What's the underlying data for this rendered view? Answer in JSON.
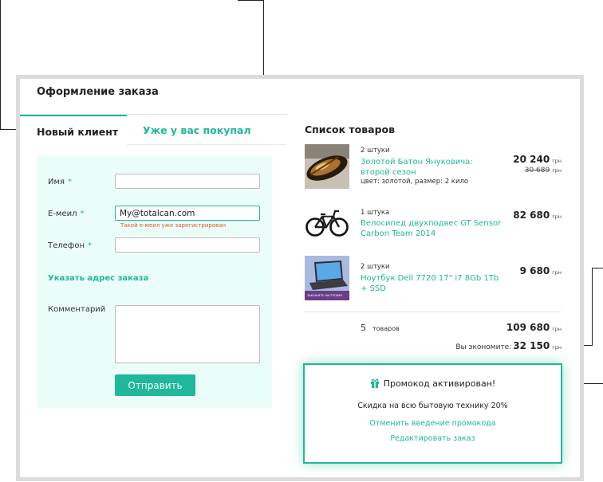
{
  "header": {
    "title": "Оформление заказа"
  },
  "tabs": [
    {
      "label": "Новый клиент",
      "active": true
    },
    {
      "label": "Уже у вас покупал",
      "active": false
    }
  ],
  "form": {
    "name_label": "Имя",
    "email_label": "Е-меил",
    "phone_label": "Телефон",
    "required_mark": "*",
    "name_value": "",
    "email_value": "My@totalcan.com",
    "phone_value": "",
    "email_error": "Такой е-меил уже зарегистрирован",
    "address_link": "Указать адрес заказа",
    "comment_label": "Комментарий",
    "comment_value": "",
    "submit_label": "Отправить"
  },
  "cart": {
    "title": "Список товаров",
    "currency": "грн",
    "items": [
      {
        "qty": "2 штуки",
        "name": "Золотой Батон Януковича: второй сезон",
        "meta": "цвет: золотой, размер: 2 кило",
        "price": "20 240",
        "old_price": "30 689",
        "image": "golden-loaf-image"
      },
      {
        "qty": "1 штука",
        "name": "Велосипед двухподвес GT Sensor Carbon Team 2014",
        "price": "82 680",
        "image": "bicycle-image"
      },
      {
        "qty": "2 штуки",
        "name": "Ноутбук Dell 7720 17\" i7 8Gb 1Tb + SSD",
        "price": "9 680",
        "image": "laptop-image",
        "image_caption": "ЗАКАЖИТЕ НАСТРОЙКУ"
      }
    ],
    "count_number": "5",
    "count_label": "товаров",
    "total": "109 680",
    "saving_label": "Вы экономите:",
    "saving_value": "32 150"
  },
  "promo": {
    "title": "Промокод активирован!",
    "description": "Скидка на всю бытовую технику 20%",
    "cancel_link": "Отменить введение промокода",
    "edit_link": "Редактировать заказ"
  },
  "colors": {
    "accent": "#1fb89a",
    "form_bg": "#ebfdf8",
    "error": "#e35b1d"
  }
}
